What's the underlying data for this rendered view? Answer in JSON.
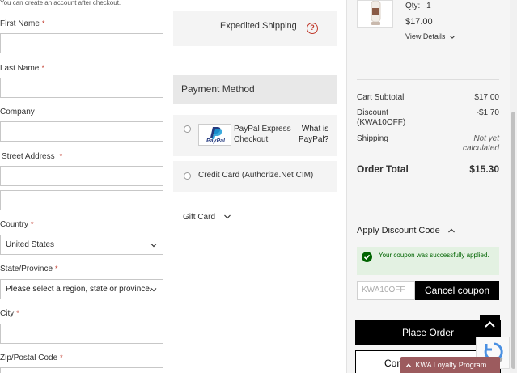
{
  "form": {
    "hint": "You can create an account after checkout.",
    "required_mark": "*",
    "first_name_label": "First Name",
    "last_name_label": "Last Name",
    "company_label": "Company",
    "street_label": "Street Address",
    "country_label": "Country",
    "country_value": "United States",
    "state_label": "State/Province",
    "state_value": "Please select a region, state or province.",
    "city_label": "City",
    "zip_label": "Zip/Postal Code"
  },
  "shipping": {
    "method_label": "Expedited Shipping",
    "help": "?"
  },
  "payment": {
    "heading": "Payment Method",
    "paypal_label_1": "PayPal Express",
    "paypal_label_2": "Checkout",
    "paypal_logo_text": "PayPal",
    "what_is_1": "What is",
    "what_is_2": "PayPal?",
    "credit_card_label": "Credit Card (Authorize.Net CIM)",
    "gift_card_label": "Gift Card"
  },
  "summary": {
    "qty_label": "Qty:",
    "qty_value": "1",
    "item_price": "$17.00",
    "view_details": "View Details",
    "subtotal_label": "Cart Subtotal",
    "subtotal_value": "$17.00",
    "discount_label": "Discount",
    "discount_code": "(KWA10OFF)",
    "discount_value": "-$1.70",
    "shipping_label": "Shipping",
    "shipping_value_1": "Not yet",
    "shipping_value_2": "calculated",
    "total_label": "Order Total",
    "total_value": "$15.30"
  },
  "discount": {
    "heading": "Apply Discount Code",
    "success_message": "Your coupon was successfully applied.",
    "code_value": "KWA10OFF",
    "cancel_label": "Cancel coupon"
  },
  "actions": {
    "place_order": "Place Order",
    "continue_partial": "Con",
    "loyalty": "KWA Loyalty Program"
  },
  "colors": {
    "required": "#c0392b",
    "success_bg": "#e3f1e2",
    "success_text": "#006400",
    "loyalty_bg": "#9c5b5e",
    "button_bg": "#000000"
  }
}
